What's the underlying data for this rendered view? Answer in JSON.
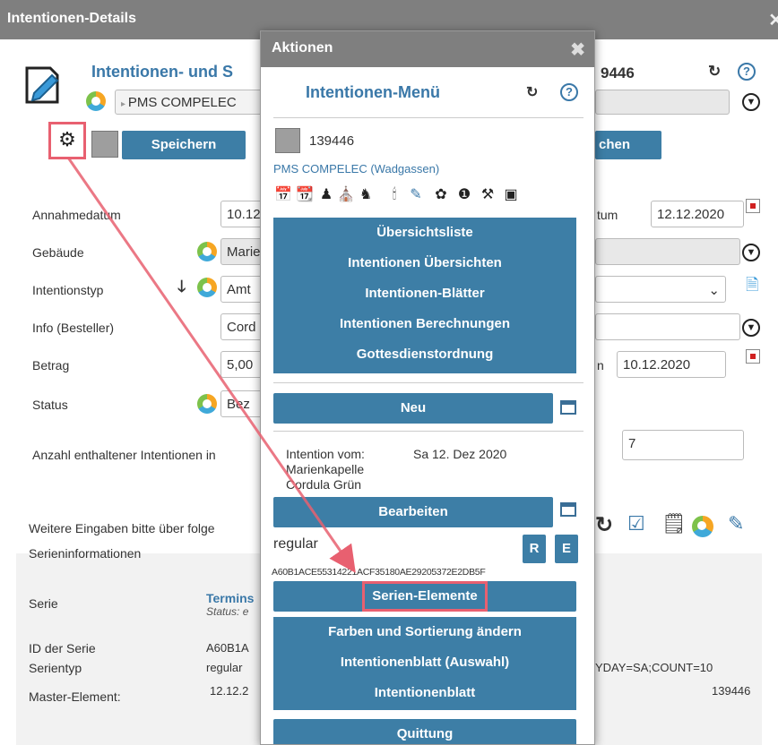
{
  "window": {
    "title": "Intentionen-Details"
  },
  "header": {
    "title": "Intentionen- und S",
    "id": "9446",
    "owner_select": "PMS COMPELEC",
    "save_label": "Speichern",
    "search_label": "chen"
  },
  "form": {
    "rows": [
      {
        "label": "Annahmedatum",
        "value": "10.12",
        "right_label": "tum",
        "right_value": "12.12.2020"
      },
      {
        "label": "Gebäude",
        "value": "Marie"
      },
      {
        "label": "Intentionstyp",
        "value": "Amt"
      },
      {
        "label": "Info (Besteller)",
        "value": "Cord"
      },
      {
        "label": "Betrag",
        "value": "5,00",
        "right_label": "n",
        "right_value": "10.12.2020"
      },
      {
        "label": "Status",
        "value": "Bez"
      }
    ],
    "count_label": "Anzahl enthaltener Intentionen in",
    "count_value": "7",
    "more_label": "Weitere Eingaben bitte über folge"
  },
  "series": {
    "heading": "Serieninformationen",
    "serie_label": "Serie",
    "serie_link": "Termins",
    "serie_status": "Status: e",
    "id_label": "ID der Serie",
    "id_value": "A60B1A",
    "type_label": "Serientyp",
    "type_value": "regular",
    "rrule": "YDAY=SA;COUNT=10",
    "master_label": "Master-Element:",
    "master_value": "12.12.2",
    "master_id": "139446"
  },
  "dialog": {
    "title": "Aktionen",
    "menu_title": "Intentionen-Menü",
    "item_id": "139446",
    "owner": "PMS COMPELEC (Wadgassen)",
    "menu_items": [
      "Übersichtsliste",
      "Intentionen Übersichten",
      "Intentionen-Blätter",
      "Intentionen Berechnungen",
      "Gottesdienstordnung"
    ],
    "new_label": "Neu",
    "intention_from_label": "Intention vom:",
    "intention_date": "Sa 12. Dez 2020",
    "location": "Marienkapelle",
    "person": "Cordula Grün",
    "edit_label": "Bearbeiten",
    "series_type": "regular",
    "r_label": "R",
    "e_label": "E",
    "series_id": "A60B1ACE55314221ACF35180AE29205372E2DB5F",
    "series_elements_label": "Serien-Elemente",
    "bottom_items": [
      "Farben und Sortierung ändern",
      "Intentionenblatt (Auswahl)",
      "Intentionenblatt"
    ],
    "receipt_label": "Quittung"
  },
  "colors": {
    "accent": "#3d7ea6",
    "highlight": "#e86070",
    "titlebar": "#7f7f7f"
  },
  "icons": [
    "gear-icon",
    "refresh-icon",
    "help-icon",
    "down-circle-icon",
    "calendar-icon",
    "close-icon",
    "edit-document-icon"
  ]
}
